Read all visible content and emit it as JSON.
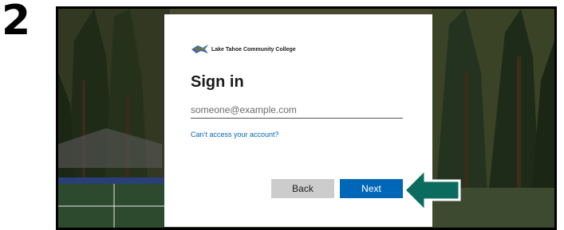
{
  "step_number": "2",
  "org_name": "Lake Tahoe Community College",
  "title": "Sign in",
  "email_input": {
    "placeholder": "someone@example.com",
    "value": ""
  },
  "cant_access_link": "Can’t access your account?",
  "buttons": {
    "back_label": "Back",
    "next_label": "Next"
  },
  "colors": {
    "primary": "#0067b8",
    "secondary_button": "#cccccc",
    "annotation_arrow": "#0b6b5e"
  },
  "icons": {
    "logo": "ltcc-logo-icon",
    "annotation": "pointer-arrow-icon"
  }
}
